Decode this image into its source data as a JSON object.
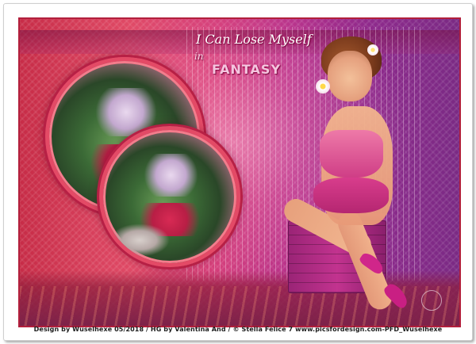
{
  "artwork": {
    "title_line_1": "I Can Lose Myself",
    "title_line_2": "in",
    "title_line_3": "FANTASY"
  },
  "footer": {
    "credit": "Design by Wuselhexe 05/2018 / HG by Valentina And / © Stella Felice 7 www.picsfordesign.com-PFD_Wuselhexe"
  },
  "colors": {
    "frame_border": "#b21f3c",
    "ring": "#e34a66",
    "background_left": "#c72c47",
    "background_right": "#7a2a84"
  }
}
